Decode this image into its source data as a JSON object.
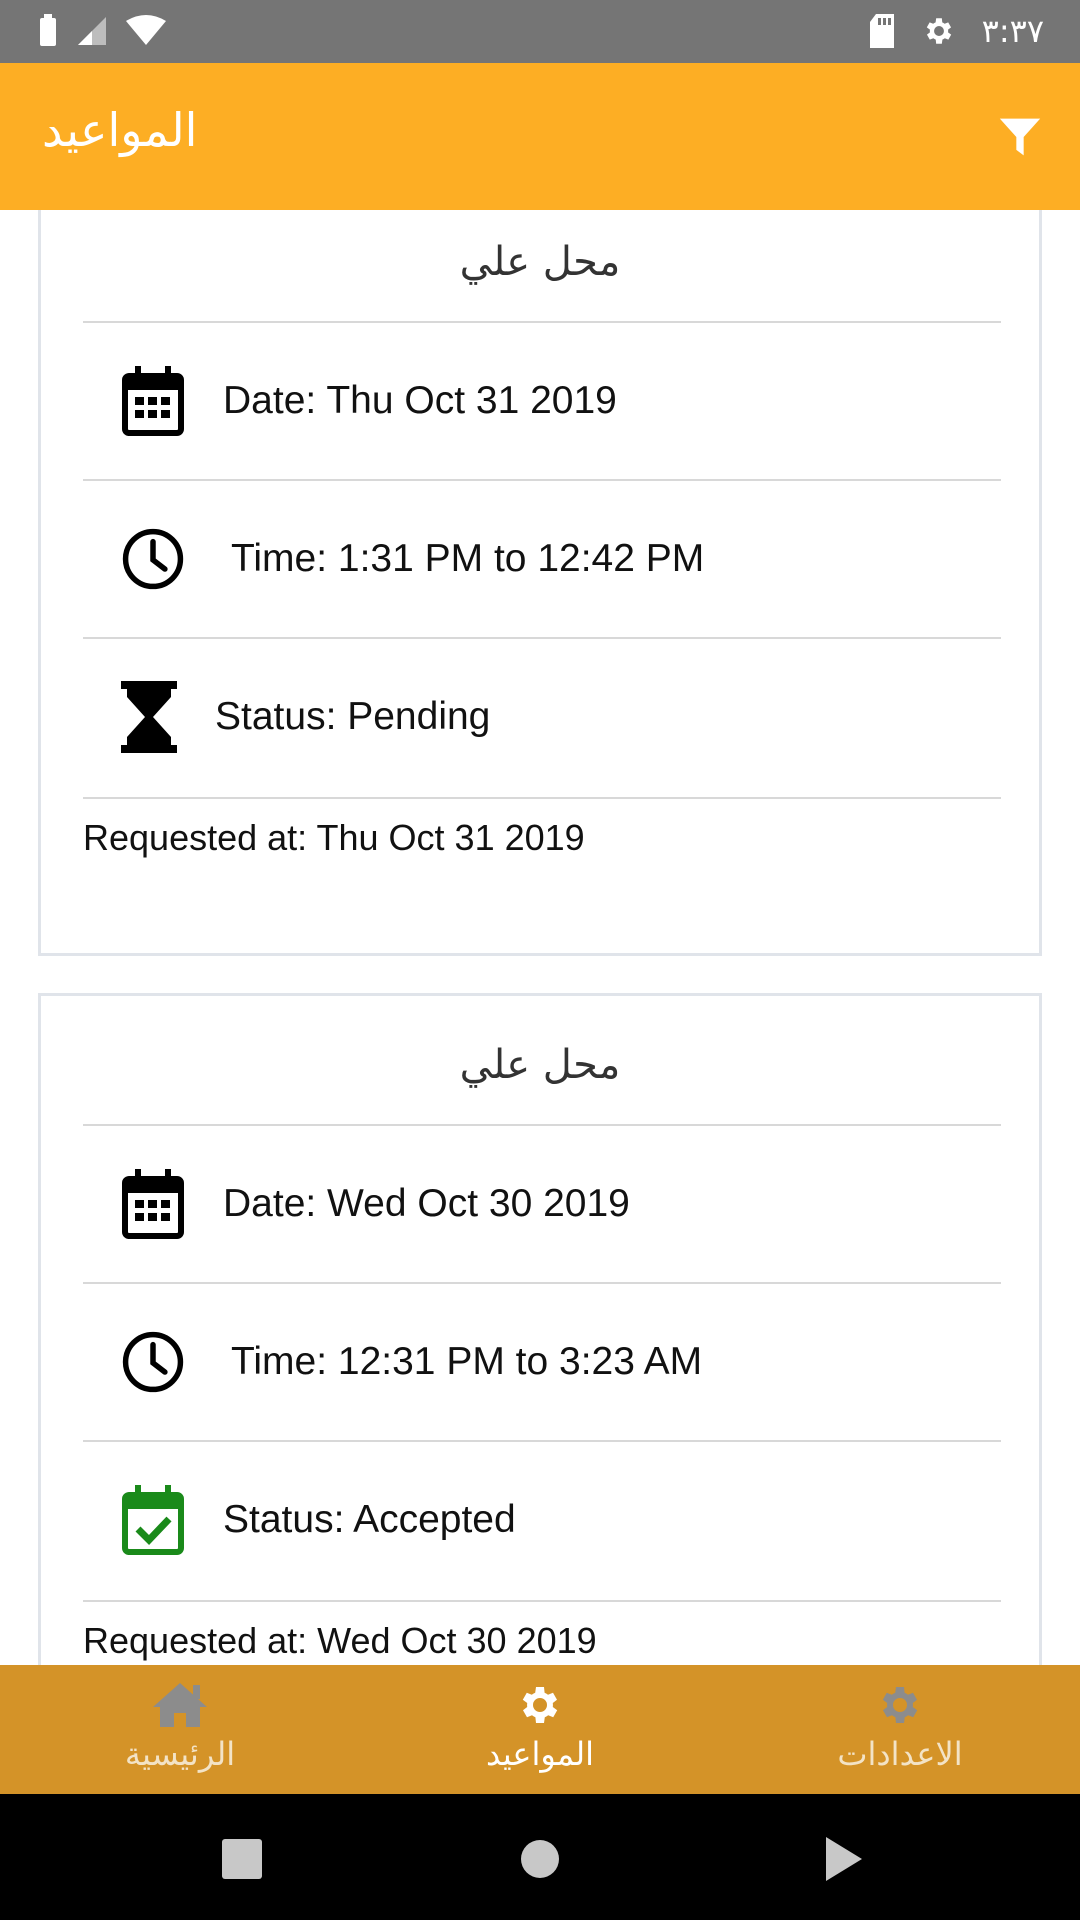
{
  "status_bar": {
    "time": "٣:٣٧",
    "icons": [
      "battery-icon",
      "signal-icon",
      "wifi-icon",
      "sd-card-icon",
      "settings-gear-icon"
    ]
  },
  "app_bar": {
    "title": "المواعيد",
    "filter_icon": "filter-icon",
    "color": "#FDAE24"
  },
  "appointments": [
    {
      "shop": "محل علي",
      "date": "Date: Thu Oct 31 2019",
      "time": "Time: 1:31 PM to 12:42 PM",
      "status": "Status: Pending",
      "status_icon": "hourglass-icon",
      "requested": "Requested at: Thu Oct 31 2019"
    },
    {
      "shop": "محل علي",
      "date": "Date: Wed Oct 30 2019",
      "time": "Time: 12:31 PM to 3:23 AM",
      "status": "Status: Accepted",
      "status_icon": "calendar-check-icon",
      "status_color": "#1a8a1a",
      "requested": "Requested at: Wed Oct 30 2019"
    }
  ],
  "bottom_nav": {
    "color": "#D49328",
    "items": [
      {
        "label": "الرئيسية",
        "icon": "home-icon",
        "active": false
      },
      {
        "label": "المواعيد",
        "icon": "gear-icon",
        "active": true
      },
      {
        "label": "الاعدادات",
        "icon": "gear-icon",
        "active": false
      }
    ]
  },
  "system_nav": {
    "buttons": [
      "recents-square-icon",
      "home-circle-icon",
      "back-triangle-icon"
    ]
  }
}
